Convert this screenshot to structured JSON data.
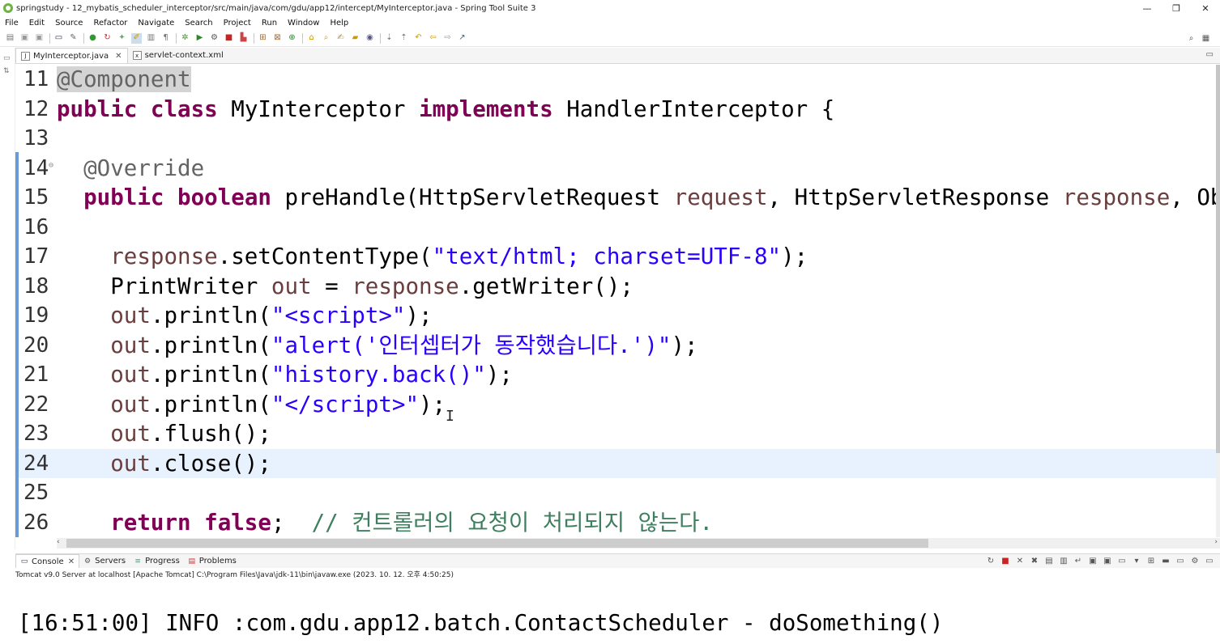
{
  "window": {
    "title": "springstudy - 12_mybatis_scheduler_interceptor/src/main/java/com/gdu/app12/intercept/MyInterceptor.java - Spring Tool Suite 3",
    "minimize": "—",
    "maximize": "❐",
    "close": "✕"
  },
  "menu": {
    "items": [
      "File",
      "Edit",
      "Source",
      "Refactor",
      "Navigate",
      "Search",
      "Project",
      "Run",
      "Window",
      "Help"
    ]
  },
  "editor_tabs": [
    {
      "label": "MyInterceptor.java",
      "icon": "java-file-icon",
      "active": true
    },
    {
      "label": "servlet-context.xml",
      "icon": "xml-file-icon",
      "active": false
    }
  ],
  "editor": {
    "lines": [
      {
        "num": "11",
        "html": "<span class=\"annhl\">@Component</span>"
      },
      {
        "num": "12",
        "html": "<span class=\"kw\">public</span> <span class=\"kw\">class</span> MyInterceptor <span class=\"kw\">implements</span> HandlerInterceptor {"
      },
      {
        "num": "13",
        "html": ""
      },
      {
        "num": "14",
        "html": "  <span class=\"ann\">@Override</span>",
        "fold": true
      },
      {
        "num": "15",
        "html": "  <span class=\"kw\">public</span> <span class=\"kw\">boolean</span> preHandle(HttpServletRequest <span class=\"var\">request</span>, HttpServletResponse <span class=\"var\">response</span>, Objec"
      },
      {
        "num": "16",
        "html": ""
      },
      {
        "num": "17",
        "html": "    <span class=\"var\">response</span>.setContentType(<span class=\"str\">\"text/html; charset=UTF-8\"</span>);"
      },
      {
        "num": "18",
        "html": "    PrintWriter <span class=\"var\">out</span> = <span class=\"var\">response</span>.getWriter();"
      },
      {
        "num": "19",
        "html": "    <span class=\"var\">out</span>.println(<span class=\"str\">\"&lt;script&gt;\"</span>);"
      },
      {
        "num": "20",
        "html": "    <span class=\"var\">out</span>.println(<span class=\"str\">\"alert('인터셉터가 동작했습니다.')\"</span>);"
      },
      {
        "num": "21",
        "html": "    <span class=\"var\">out</span>.println(<span class=\"str\">\"history.back()\"</span>);"
      },
      {
        "num": "22",
        "html": "    <span class=\"var\">out</span>.println(<span class=\"str\">\"&lt;/script&gt;\"</span>);"
      },
      {
        "num": "23",
        "html": "    <span class=\"var\">out</span>.flush();"
      },
      {
        "num": "24",
        "html": "    <span class=\"var\">out</span>.close();",
        "current": true
      },
      {
        "num": "25",
        "html": ""
      },
      {
        "num": "26",
        "html": "    <span class=\"kw\">return</span> <span class=\"kw\">false</span>;  <span class=\"cmt\">// 컨트롤러의 요청이 처리되지 않는다.</span>"
      }
    ]
  },
  "bottom_tabs": [
    {
      "label": "Console",
      "icon": "console-icon",
      "active": true,
      "closable": true
    },
    {
      "label": "Servers",
      "icon": "servers-icon",
      "active": false
    },
    {
      "label": "Progress",
      "icon": "progress-icon",
      "active": false
    },
    {
      "label": "Problems",
      "icon": "problems-icon",
      "active": false
    }
  ],
  "console": {
    "description": "Tomcat v9.0 Server at localhost [Apache Tomcat] C:\\Program Files\\Java\\jdk-11\\bin\\javaw.exe  (2023. 10. 12. 오후 4:50:25)",
    "output": "[16:51:00] INFO :com.gdu.app12.batch.ContactScheduler - doSomething()"
  },
  "colors": {
    "keyword": "#7f0055",
    "string": "#2a00ff",
    "comment": "#3f7f5f",
    "annotation": "#646464",
    "variable": "#6a3e3e",
    "current_line": "#e8f2fe"
  }
}
